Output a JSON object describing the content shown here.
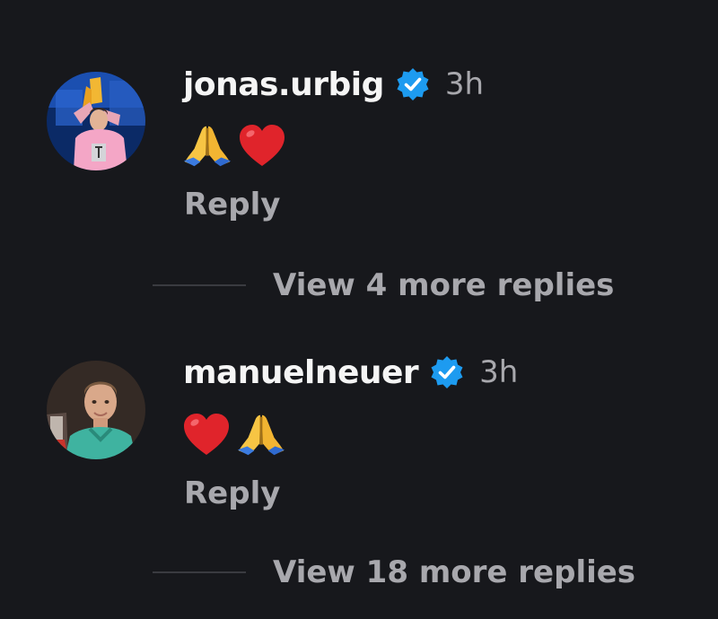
{
  "comments": [
    {
      "username": "jonas.urbig",
      "time": "3h",
      "verified": true,
      "emojis": [
        "folded-hands",
        "red-heart"
      ],
      "reply_label": "Reply",
      "view_more_label": "View 4 more replies"
    },
    {
      "username": "manuelneuer",
      "time": "3h",
      "verified": true,
      "emojis": [
        "red-heart",
        "folded-hands"
      ],
      "reply_label": "Reply",
      "view_more_label": "View 18 more replies"
    }
  ],
  "colors": {
    "background": "#17181c",
    "verified_badge": "#1d9bf0",
    "muted_text": "#a8a8ad"
  }
}
